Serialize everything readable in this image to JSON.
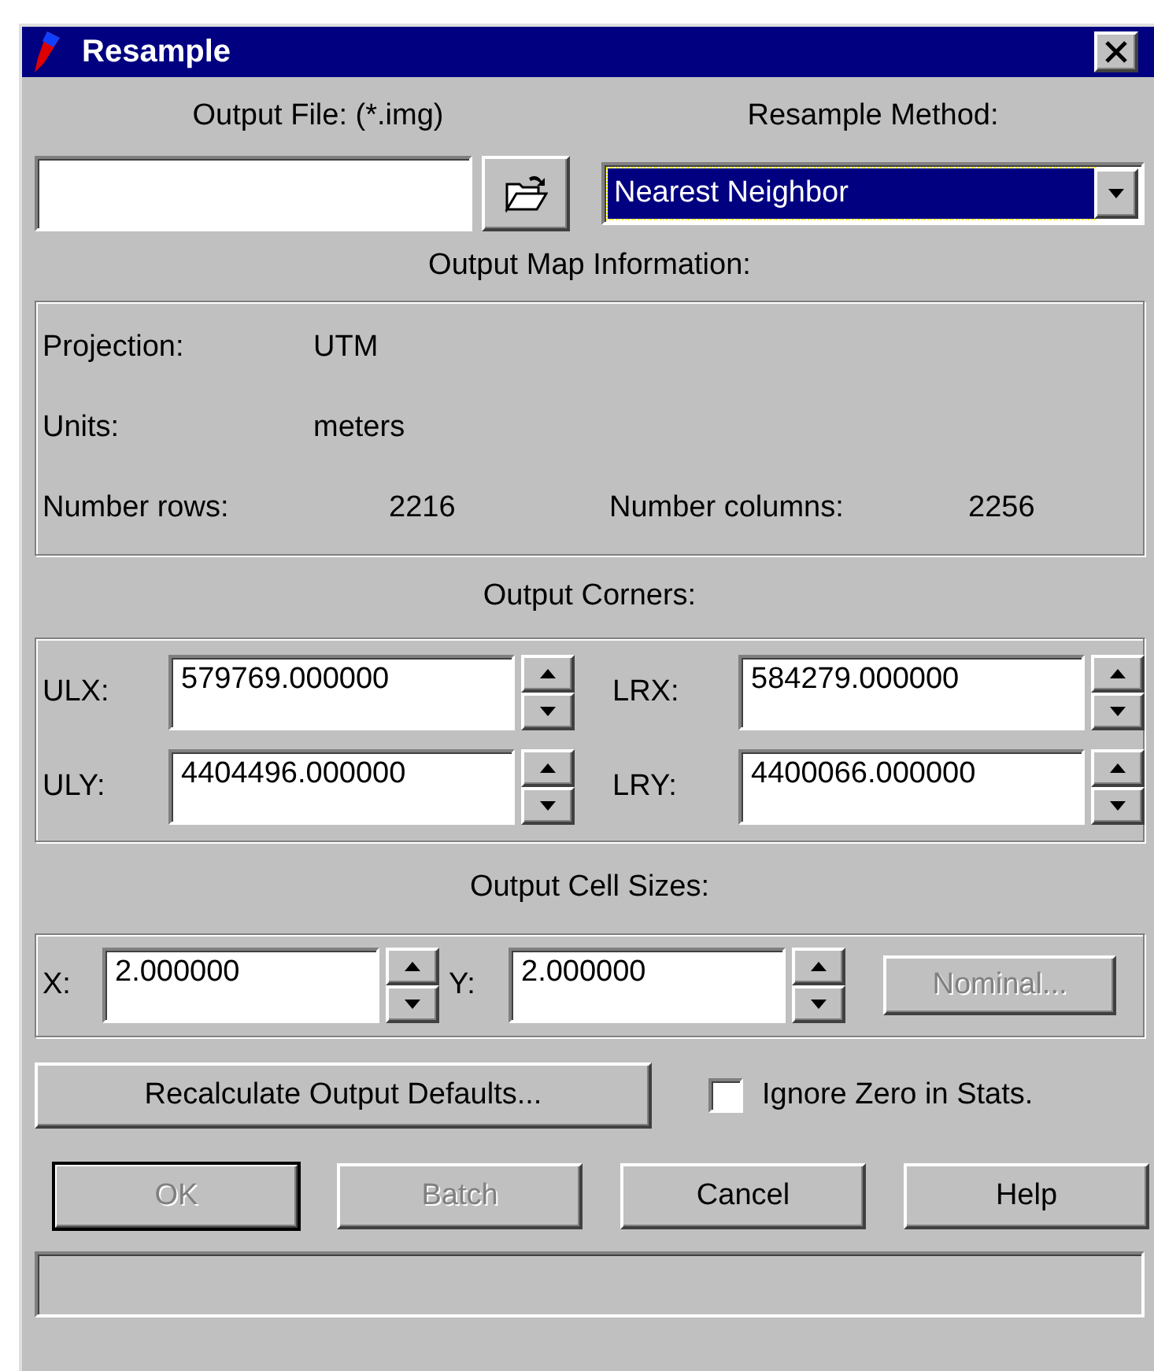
{
  "window": {
    "title": "Resample"
  },
  "output_file": {
    "label": "Output File: (*.img)"
  },
  "method": {
    "label": "Resample Method:",
    "value": "Nearest Neighbor"
  },
  "map_info": {
    "heading": "Output Map Information:",
    "rows": [
      [
        {
          "label": "Projection:",
          "value": "UTM"
        }
      ],
      [
        {
          "label": "Units:",
          "value": "meters"
        }
      ],
      [
        {
          "label": "Number rows:",
          "value": "2216"
        },
        {
          "label": "Number columns:",
          "value": "2256"
        }
      ]
    ]
  },
  "corners": {
    "heading": "Output Corners:",
    "fields": [
      {
        "label": "ULX:",
        "value": "579769.000000"
      },
      {
        "label": "LRX:",
        "value": "584279.000000"
      },
      {
        "label": "ULY:",
        "value": "4404496.000000"
      },
      {
        "label": "LRY:",
        "value": "4400066.000000"
      }
    ]
  },
  "cell_sizes": {
    "heading": "Output Cell Sizes:",
    "fields": [
      {
        "label": "X:",
        "value": "2.000000"
      },
      {
        "label": "Y:",
        "value": "2.000000"
      }
    ],
    "nominal": {
      "label": "Nominal...",
      "disabled": true
    }
  },
  "recalculate": {
    "label": "Recalculate Output Defaults..."
  },
  "ignore_zero": {
    "label": "Ignore Zero in Stats.",
    "checked": false
  },
  "buttons": [
    {
      "label": "OK",
      "disabled": true,
      "default": true
    },
    {
      "label": "Batch",
      "disabled": true,
      "default": false
    },
    {
      "label": "Cancel",
      "disabled": false,
      "default": false
    },
    {
      "label": "Help",
      "disabled": false,
      "default": false
    }
  ]
}
